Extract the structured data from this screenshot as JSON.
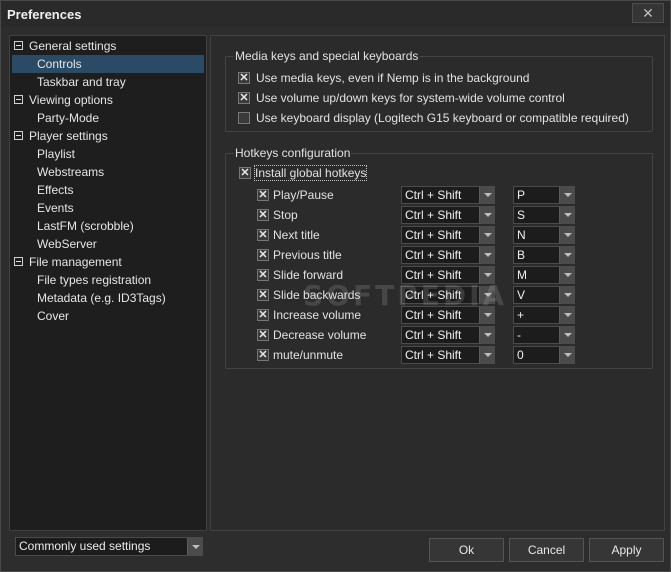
{
  "window": {
    "title": "Preferences",
    "close_glyph": "✕"
  },
  "tree": [
    {
      "label": "General settings",
      "level": 0,
      "expander": true,
      "selected": false
    },
    {
      "label": "Controls",
      "level": 1,
      "expander": false,
      "selected": true
    },
    {
      "label": "Taskbar and tray",
      "level": 1,
      "expander": false,
      "selected": false
    },
    {
      "label": "Viewing options",
      "level": 0,
      "expander": true,
      "selected": false
    },
    {
      "label": "Party-Mode",
      "level": 1,
      "expander": false,
      "selected": false
    },
    {
      "label": "Player settings",
      "level": 0,
      "expander": true,
      "selected": false
    },
    {
      "label": "Playlist",
      "level": 1,
      "expander": false,
      "selected": false
    },
    {
      "label": "Webstreams",
      "level": 1,
      "expander": false,
      "selected": false
    },
    {
      "label": "Effects",
      "level": 1,
      "expander": false,
      "selected": false
    },
    {
      "label": "Events",
      "level": 1,
      "expander": false,
      "selected": false
    },
    {
      "label": "LastFM (scrobble)",
      "level": 1,
      "expander": false,
      "selected": false
    },
    {
      "label": "WebServer",
      "level": 1,
      "expander": false,
      "selected": false
    },
    {
      "label": "File management",
      "level": 0,
      "expander": true,
      "selected": false
    },
    {
      "label": "File types registration",
      "level": 1,
      "expander": false,
      "selected": false
    },
    {
      "label": "Metadata (e.g. ID3Tags)",
      "level": 1,
      "expander": false,
      "selected": false
    },
    {
      "label": "Cover",
      "level": 1,
      "expander": false,
      "selected": false
    }
  ],
  "media_group": {
    "title": "Media keys and special keyboards",
    "options": [
      {
        "label": "Use media keys, even if Nemp is in the background",
        "checked": true
      },
      {
        "label": "Use volume up/down keys for system-wide volume control",
        "checked": true
      },
      {
        "label": "Use keyboard display (Logitech G15 keyboard or compatible required)",
        "checked": false
      }
    ]
  },
  "hotkeys_group": {
    "title": "Hotkeys configuration",
    "install_label": "Install global hotkeys",
    "install_checked": true,
    "rows": [
      {
        "label": "Play/Pause",
        "checked": true,
        "modifier": "Ctrl + Shift",
        "key": "P"
      },
      {
        "label": "Stop",
        "checked": true,
        "modifier": "Ctrl + Shift",
        "key": "S"
      },
      {
        "label": "Next title",
        "checked": true,
        "modifier": "Ctrl + Shift",
        "key": "N"
      },
      {
        "label": "Previous title",
        "checked": true,
        "modifier": "Ctrl + Shift",
        "key": "B"
      },
      {
        "label": "Slide forward",
        "checked": true,
        "modifier": "Ctrl + Shift",
        "key": "M"
      },
      {
        "label": "Slide backwards",
        "checked": true,
        "modifier": "Ctrl + Shift",
        "key": "V"
      },
      {
        "label": "Increase volume",
        "checked": true,
        "modifier": "Ctrl + Shift",
        "key": "+"
      },
      {
        "label": "Decrease volume",
        "checked": true,
        "modifier": "Ctrl + Shift",
        "key": "-"
      },
      {
        "label": "mute/unmute",
        "checked": true,
        "modifier": "Ctrl + Shift",
        "key": "0"
      }
    ]
  },
  "footer": {
    "settings_filter": "Commonly used settings",
    "ok_label": "Ok",
    "cancel_label": "Cancel",
    "apply_label": "Apply"
  },
  "watermark": "SOFTPEDIA",
  "colors": {
    "background": "#2b2b2b",
    "tree_background": "#1e1e1e",
    "selection": "#2b4a66",
    "text": "#e2e2e2"
  }
}
